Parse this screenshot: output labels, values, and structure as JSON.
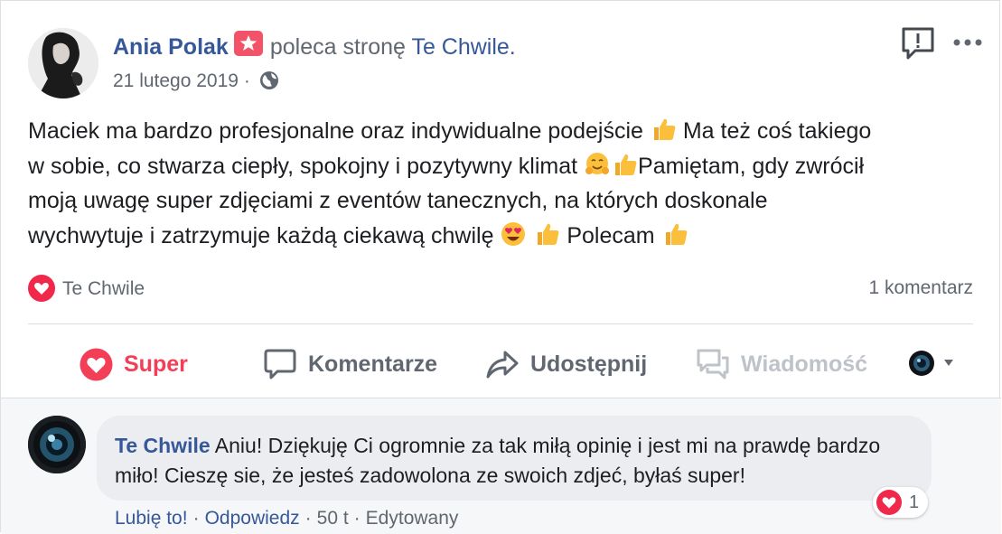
{
  "post": {
    "author": "Ania Polak",
    "verb": "poleca stronę",
    "page": "Te Chwile.",
    "date": "21 lutego 2019",
    "date_separator": "·",
    "privacy_icon": "globe-icon",
    "text": {
      "line1": "Maciek ma bardzo profesjonalne oraz indywidualne podejście",
      "line1b": "Ma też coś takiego",
      "line2": "w sobie, co stwarza ciepły, spokojny i pozytywny klimat",
      "line2b": "Pamiętam, gdy zwrócił",
      "line3": "moją uwagę super zdjęciami z eventów tanecznych, na których doskonale",
      "line4": "wychwytuje i zatrzymuje każdą ciekawą chwilę",
      "line4b": "Polecam"
    },
    "reaction_by": "Te Chwile",
    "comment_count": "1 komentarz",
    "accent": "#365899",
    "love_color": "#f33e58"
  },
  "actions": {
    "super": "Super",
    "comment": "Komentarze",
    "share": "Udostępnij",
    "message": "Wiadomość"
  },
  "comment": {
    "author": "Te Chwile",
    "text": "Aniu! Dziękuję Ci ogromnie za tak miłą opinię i jest mi na prawdę bardzo miło! Cieszę sie, że jesteś zadowolona ze swoich zdjeć, byłaś super!",
    "reaction_count": "1",
    "like": "Lubię to!",
    "reply": "Odpowiedz",
    "age": "50 t",
    "edited": "Edytowany",
    "sep": "·"
  }
}
